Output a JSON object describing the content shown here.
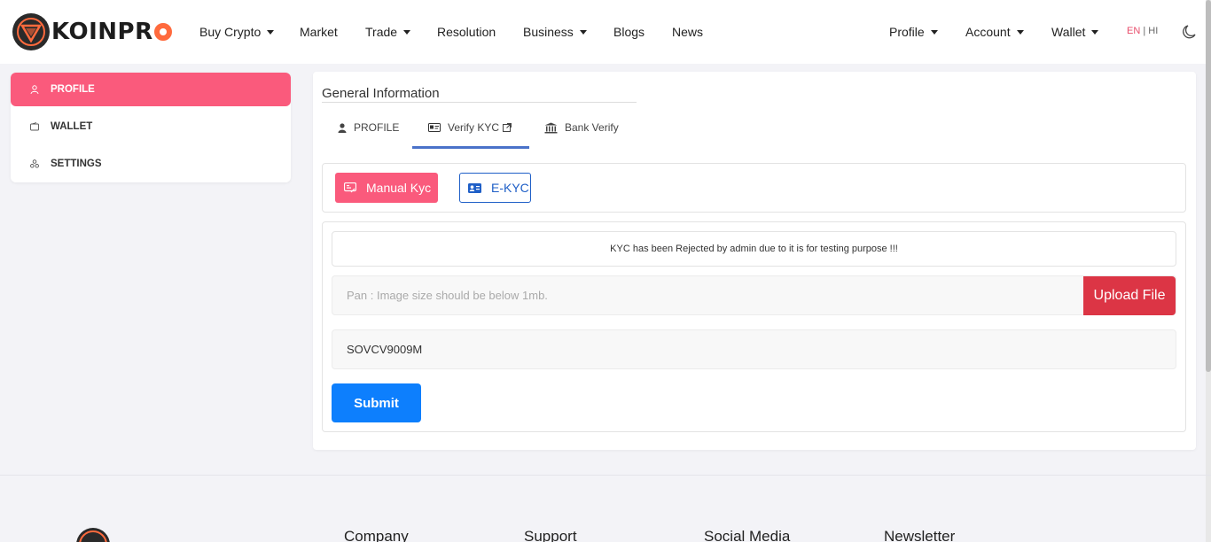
{
  "brand": {
    "name_prefix": "KOINPR"
  },
  "nav": {
    "buy_crypto": "Buy Crypto",
    "market": "Market",
    "trade": "Trade",
    "resolution": "Resolution",
    "business": "Business",
    "blogs": "Blogs",
    "news": "News",
    "profile": "Profile",
    "account": "Account",
    "wallet": "Wallet"
  },
  "lang": {
    "en": "EN",
    "sep": " | ",
    "hi": "HI"
  },
  "sidebar": {
    "items": [
      {
        "label": "PROFILE",
        "icon": "user-icon",
        "active": true
      },
      {
        "label": "WALLET",
        "icon": "wallet-icon",
        "active": false
      },
      {
        "label": "SETTINGS",
        "icon": "settings-icon",
        "active": false
      }
    ]
  },
  "main": {
    "title": "General Information",
    "tabs": [
      {
        "label": "PROFILE",
        "icon": "person-icon"
      },
      {
        "label": "Verify KYC",
        "icon": "id-card-icon",
        "active": true
      },
      {
        "label": "Bank Verify",
        "icon": "bank-icon"
      }
    ],
    "kyc_buttons": {
      "manual": "Manual Kyc",
      "ekyc": "E-KYC"
    },
    "notice": "KYC has been Rejected by admin due to it is for testing purpose !!!",
    "file_placeholder": "Pan : Image size should be below 1mb.",
    "upload_label": "Upload File",
    "pan_value": "SOVCV9009M",
    "submit_label": "Submit"
  },
  "footer": {
    "columns": [
      "Company",
      "Support",
      "Social Media",
      "Newsletter"
    ]
  },
  "colors": {
    "accent_pink": "#fa5a7c",
    "primary_blue": "#0d7ffd",
    "danger_red": "#dc3545",
    "outline_blue": "#1f5fc7"
  }
}
